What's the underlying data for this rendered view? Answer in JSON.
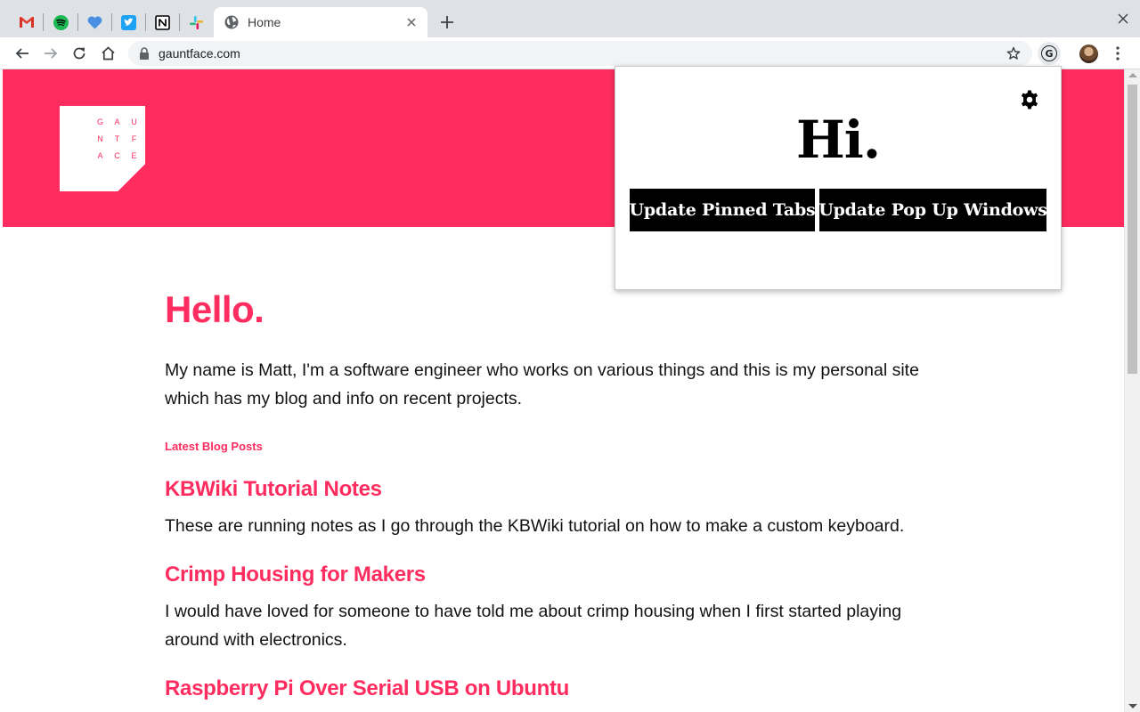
{
  "browser": {
    "pinned_tabs": [
      {
        "name": "gmail",
        "icon": "gmail-icon"
      },
      {
        "name": "spotify",
        "icon": "spotify-icon"
      },
      {
        "name": "heart",
        "icon": "heart-icon"
      },
      {
        "name": "twitter",
        "icon": "twitter-icon"
      },
      {
        "name": "notion",
        "icon": "notion-icon"
      },
      {
        "name": "slack",
        "icon": "slack-icon"
      }
    ],
    "active_tab": {
      "title": "Home",
      "icon": "globe-icon"
    },
    "url": "gauntface.com",
    "extension_badge": "G"
  },
  "page": {
    "logo_letters": [
      "G",
      "A",
      "U",
      "N",
      "T",
      "F",
      "A",
      "C",
      "E"
    ],
    "hello": "Hello.",
    "intro": "My name is Matt, I'm a software engineer who works on various things and this is my personal site which has my blog and info on recent projects.",
    "latest_label": "Latest Blog Posts",
    "posts": [
      {
        "title": "KBWiki Tutorial Notes",
        "excerpt": "These are running notes as I go through the KBWiki tutorial on how to make a custom keyboard."
      },
      {
        "title": "Crimp Housing for Makers",
        "excerpt": "I would have loved for someone to have told me about crimp housing when I first started playing around with electronics."
      },
      {
        "title": "Raspberry Pi Over Serial USB on Ubuntu",
        "excerpt": ""
      }
    ]
  },
  "popup": {
    "greeting": "Hi.",
    "pinned_button": "Update Pinned Tabs",
    "popup_button": "Update Pop Up Windows"
  },
  "colors": {
    "brand": "#ff2c5f",
    "tabstrip": "#dee1e6",
    "button_bg": "#000000"
  }
}
